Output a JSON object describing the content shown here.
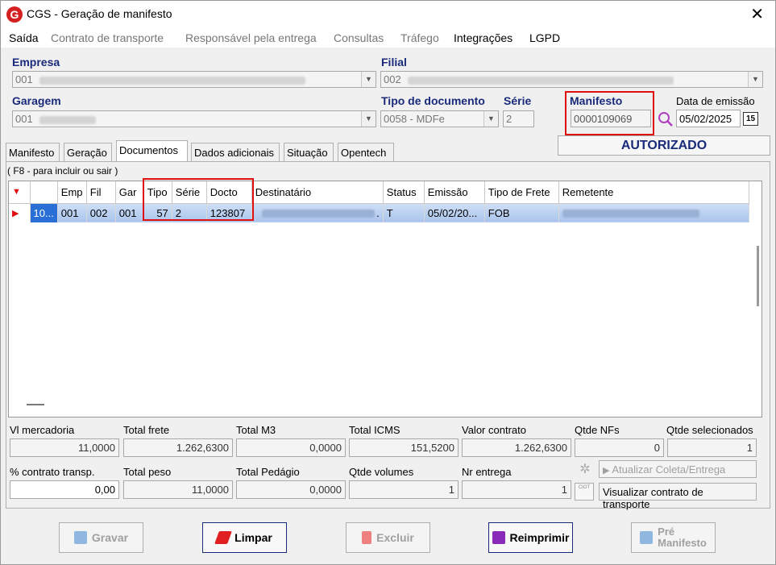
{
  "window": {
    "title": "CGS - Geração de manifesto",
    "logo_letter": "G",
    "close_glyph": "✕"
  },
  "menu": [
    "Saída",
    "Contrato de transporte",
    "Responsável pela entrega",
    "Consultas",
    "Tráfego",
    "Integrações",
    "LGPD"
  ],
  "form": {
    "empresa_label": "Empresa",
    "empresa_value": "001",
    "filial_label": "Filial",
    "filial_value": "002",
    "garagem_label": "Garagem",
    "garagem_value": "001",
    "tipo_doc_label": "Tipo de documento",
    "tipo_doc_value": "0058 - MDFe",
    "serie_label": "Série",
    "serie_value": "2",
    "manifesto_label": "Manifesto",
    "manifesto_value": "0000109069",
    "data_emissao_label": "Data de emissão",
    "data_emissao_value": "05/02/2025",
    "calendar_glyph": "15",
    "status": "AUTORIZADO"
  },
  "tabs": [
    "Manifesto",
    "Geração",
    "Documentos",
    "Dados adicionais",
    "Situação",
    "Opentech"
  ],
  "hint": "( F8 - para incluir ou sair )",
  "grid": {
    "columns": [
      "Emp",
      "Fil",
      "Gar",
      "Tipo",
      "Série",
      "Docto",
      "Destinatário",
      "Status",
      "Emissão",
      "Tipo de Frete",
      "Remetente"
    ],
    "row": {
      "id": "10...",
      "emp": "001",
      "fil": "002",
      "gar": "001",
      "tipo": "57",
      "serie": "2",
      "docto": "123807",
      "destinatario": ".",
      "status": "T",
      "emissao": "05/02/20...",
      "frete": "FOB",
      "remetente": ""
    }
  },
  "totals": {
    "vl_mercadoria_label": "Vl mercadoria",
    "vl_mercadoria": "11,0000",
    "total_frete_label": "Total frete",
    "total_frete": "1.262,6300",
    "total_m3_label": "Total M3",
    "total_m3": "0,0000",
    "total_icms_label": "Total ICMS",
    "total_icms": "151,5200",
    "valor_contrato_label": "Valor contrato",
    "valor_contrato": "1.262,6300",
    "qtde_nfs_label": "Qtde NFs",
    "qtde_nfs": "0",
    "qtde_sel_label": "Qtde selecionados",
    "qtde_sel": "1",
    "pct_contrato_label": "% contrato transp.",
    "pct_contrato": "0,00",
    "total_peso_label": "Total peso",
    "total_peso": "11,0000",
    "total_pedagio_label": "Total Pedágio",
    "total_pedagio": "0,0000",
    "qtde_volumes_label": "Qtde volumes",
    "qtde_volumes": "1",
    "nr_entrega_label": "Nr entrega",
    "nr_entrega": "1",
    "atualizar_label": "Atualizar Coleta/Entrega",
    "visualizar_label": "Visualizar contrato de transporte",
    "ciot_label": "CIOT"
  },
  "buttons": {
    "gravar": "Gravar",
    "limpar": "Limpar",
    "excluir": "Excluir",
    "reimprimir": "Reimprimir",
    "pre_manifesto_1": "Pré",
    "pre_manifesto_2": "Manifesto"
  }
}
